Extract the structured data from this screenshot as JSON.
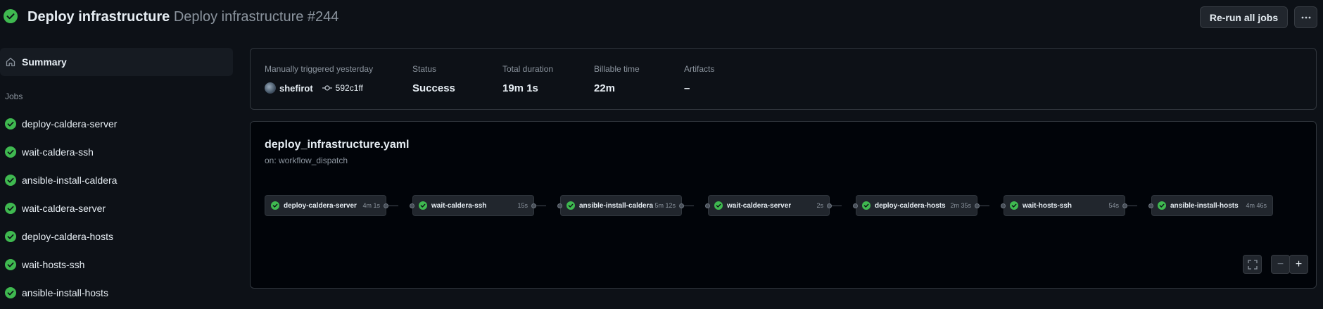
{
  "header": {
    "workflow_name": "Deploy infrastructure",
    "run_title": "Deploy infrastructure #244",
    "status_icon": "check-circle-fill-icon",
    "rerun_label": "Re-run all jobs",
    "more_icon": "kebab-horizontal-icon"
  },
  "sidebar": {
    "summary_label": "Summary",
    "summary_icon": "home-icon",
    "jobs_heading": "Jobs",
    "jobs": [
      {
        "label": "deploy-caldera-server"
      },
      {
        "label": "wait-caldera-ssh"
      },
      {
        "label": "ansible-install-caldera"
      },
      {
        "label": "wait-caldera-server"
      },
      {
        "label": "deploy-caldera-hosts"
      },
      {
        "label": "wait-hosts-ssh"
      },
      {
        "label": "ansible-install-hosts"
      }
    ]
  },
  "summary": {
    "trigger_label": "Manually triggered yesterday",
    "actor": "shefirot",
    "commit": "592c1ff",
    "status_label": "Status",
    "status_value": "Success",
    "duration_label": "Total duration",
    "duration_value": "19m 1s",
    "billable_label": "Billable time",
    "billable_value": "22m",
    "artifacts_label": "Artifacts",
    "artifacts_value": "–"
  },
  "graph": {
    "file": "deploy_infrastructure.yaml",
    "trigger": "on: workflow_dispatch",
    "nodes": [
      {
        "name": "deploy-caldera-server",
        "duration": "4m 1s"
      },
      {
        "name": "wait-caldera-ssh",
        "duration": "15s"
      },
      {
        "name": "ansible-install-caldera",
        "duration": "5m 12s"
      },
      {
        "name": "wait-caldera-server",
        "duration": "2s"
      },
      {
        "name": "deploy-caldera-hosts",
        "duration": "2m 35s"
      },
      {
        "name": "wait-hosts-ssh",
        "duration": "54s"
      },
      {
        "name": "ansible-install-hosts",
        "duration": "4m 46s"
      }
    ],
    "fullscreen_icon": "screen-full-icon",
    "zoom_out_label": "−",
    "zoom_in_label": "+"
  },
  "colors": {
    "success": "#3fb950",
    "background": "#0d1117",
    "panel": "#161b22",
    "border": "#30363d",
    "muted_text": "#8b949e"
  }
}
